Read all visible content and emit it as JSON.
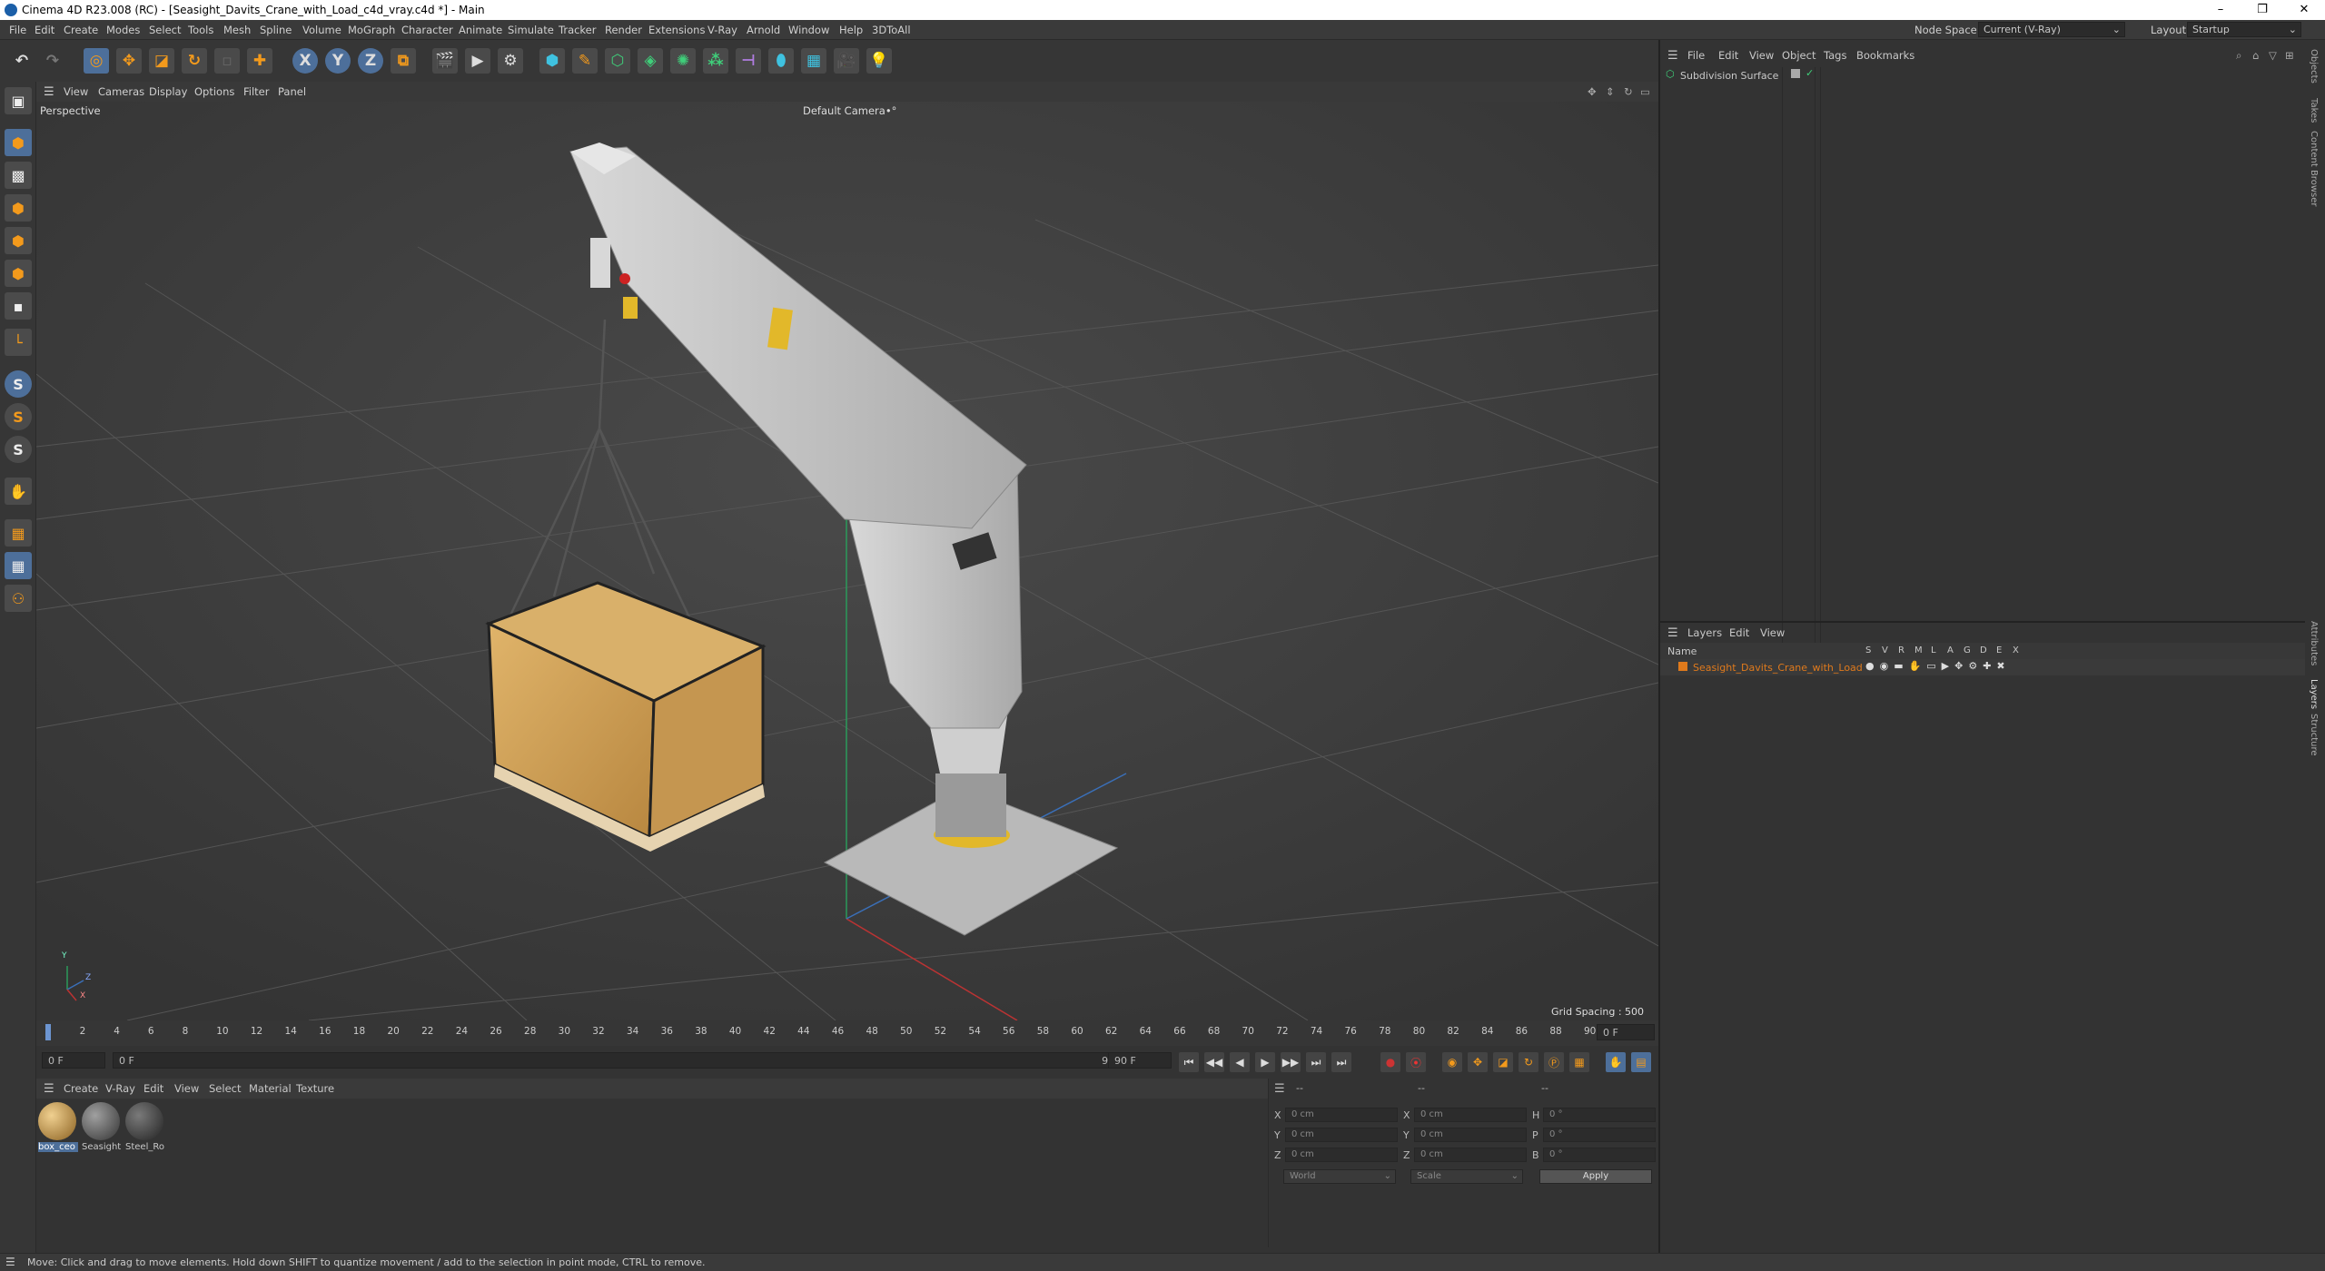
{
  "window": {
    "title": "Cinema 4D R23.008 (RC) - [Seasight_Davits_Crane_with_Load_c4d_vray.c4d *] - Main",
    "minimize": "–",
    "restore": "❐",
    "close": "✕"
  },
  "menu": [
    "File",
    "Edit",
    "Create",
    "Modes",
    "Select",
    "Tools",
    "Mesh",
    "Spline",
    "Volume",
    "MoGraph",
    "Character",
    "Animate",
    "Simulate",
    "Tracker",
    "Render",
    "Extensions",
    "V-Ray",
    "Arnold",
    "Window",
    "Help",
    "3DToAll"
  ],
  "node_space": {
    "label": "Node Space:",
    "value": "Current (V-Ray)"
  },
  "layout": {
    "label": "Layout:",
    "value": "Startup"
  },
  "toolbar": {
    "x": "X",
    "y": "Y",
    "z": "Z"
  },
  "left_tools": {
    "s1": "S",
    "s2": "S",
    "s3": "S"
  },
  "viewport": {
    "menu": [
      "View",
      "Cameras",
      "Display",
      "Options",
      "Filter",
      "Panel"
    ],
    "label": "Perspective",
    "camera": "Default Camera",
    "camera_suffix": "•°",
    "grid_spacing": "Grid Spacing : 500 cm",
    "axis": {
      "y": "Y",
      "z": "Z",
      "x": "X"
    }
  },
  "timeline": {
    "ticks": [
      "0",
      "2",
      "4",
      "6",
      "8",
      "10",
      "12",
      "14",
      "16",
      "18",
      "20",
      "22",
      "24",
      "26",
      "28",
      "30",
      "32",
      "34",
      "36",
      "38",
      "40",
      "42",
      "44",
      "46",
      "48",
      "50",
      "52",
      "54",
      "56",
      "58",
      "60",
      "62",
      "64",
      "66",
      "68",
      "70",
      "72",
      "74",
      "76",
      "78",
      "80",
      "82",
      "84",
      "86",
      "88",
      "90"
    ],
    "current_frame_right": "0 F"
  },
  "transport": {
    "start": "0 F",
    "current": "0 F",
    "end_inner": "90 F",
    "end": "90 F",
    "buttons": [
      "⏮",
      "◀◀",
      "◀",
      "▶",
      "▶▶",
      "⏭",
      "⏭"
    ]
  },
  "materials": {
    "menu": [
      "Create",
      "V-Ray",
      "Edit",
      "View",
      "Select",
      "Material",
      "Texture"
    ],
    "items": [
      {
        "label": "box_ceo",
        "color": "#c8a060"
      },
      {
        "label": "Seasight",
        "color": "#6a6a6a"
      },
      {
        "label": "Steel_Ro",
        "color": "#4a4a4a"
      }
    ]
  },
  "coords": {
    "header": [
      "--",
      "--",
      "--"
    ],
    "rows": [
      {
        "a": "X",
        "av": "0 cm",
        "b": "X",
        "bv": "0 cm",
        "c": "H",
        "cv": "0 °"
      },
      {
        "a": "Y",
        "av": "0 cm",
        "b": "Y",
        "bv": "0 cm",
        "c": "P",
        "cv": "0 °"
      },
      {
        "a": "Z",
        "av": "0 cm",
        "b": "Z",
        "bv": "0 cm",
        "c": "B",
        "cv": "0 °"
      }
    ],
    "world": "World",
    "scale": "Scale",
    "apply": "Apply"
  },
  "objects": {
    "menu": [
      "File",
      "Edit",
      "View",
      "Object",
      "Tags",
      "Bookmarks"
    ],
    "item": "Subdivision Surface"
  },
  "layers": {
    "menu": [
      "Layers",
      "Edit",
      "View"
    ],
    "name_header": "Name",
    "flags": [
      "S",
      "V",
      "R",
      "M",
      "L",
      "A",
      "G",
      "D",
      "E",
      "X"
    ],
    "item": "Seasight_Davits_Crane_with_Load",
    "item_color": "#e07a1c"
  },
  "side_tabs": [
    "Objects",
    "Takes",
    "Content Browser",
    "Attributes",
    "Layers",
    "Structure"
  ],
  "status": "Move: Click and drag to move elements. Hold down SHIFT to quantize movement / add to the selection in point mode, CTRL to remove."
}
